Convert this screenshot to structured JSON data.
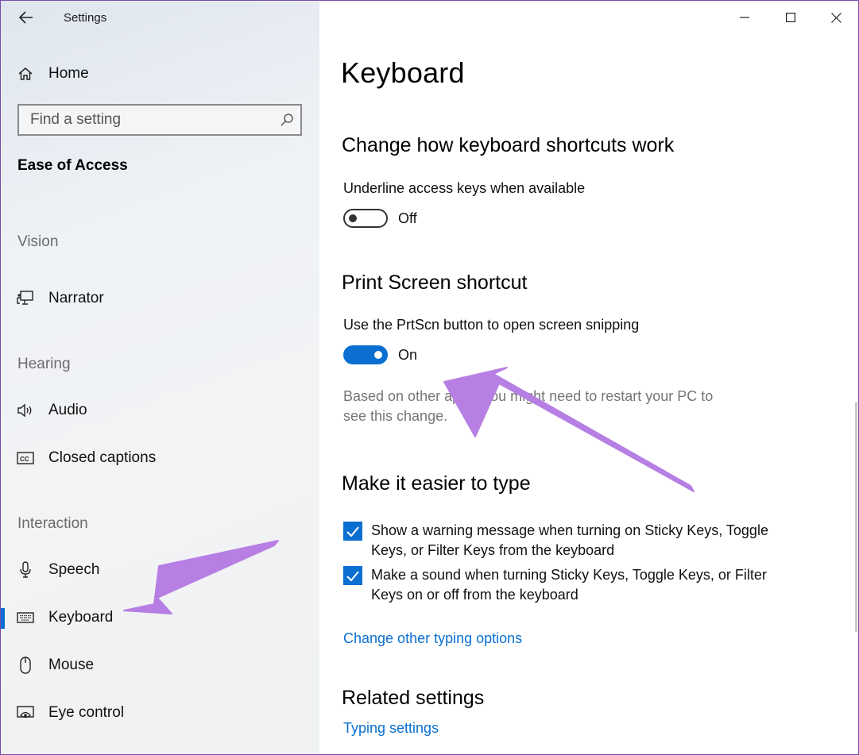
{
  "app": {
    "title": "Settings"
  },
  "sidebar": {
    "home_label": "Home",
    "search": {
      "placeholder": "Find a setting"
    },
    "section_title": "Ease of Access",
    "groups": [
      {
        "label": "Vision",
        "items": [
          {
            "label": "Narrator",
            "icon": "narrator-icon"
          }
        ]
      },
      {
        "label": "Hearing",
        "items": [
          {
            "label": "Audio",
            "icon": "speaker-icon"
          },
          {
            "label": "Closed captions",
            "icon": "closed-captions-icon"
          }
        ]
      },
      {
        "label": "Interaction",
        "items": [
          {
            "label": "Speech",
            "icon": "microphone-icon"
          },
          {
            "label": "Keyboard",
            "icon": "keyboard-icon",
            "selected": true
          },
          {
            "label": "Mouse",
            "icon": "mouse-icon"
          },
          {
            "label": "Eye control",
            "icon": "eye-control-icon"
          }
        ]
      }
    ]
  },
  "main": {
    "title": "Keyboard",
    "sections": {
      "shortcuts": {
        "heading": "Change how keyboard shortcuts work",
        "setting_label": "Underline access keys when available",
        "toggle_state": "Off"
      },
      "print_screen": {
        "heading": "Print Screen shortcut",
        "setting_label": "Use the PrtScn button to open screen snipping",
        "toggle_state": "On",
        "note_line1": "Based on other apps, you might need to restart your PC to",
        "note_line2": "see this change."
      },
      "typing": {
        "heading": "Make it easier to type",
        "checkbox1_line1": "Show a warning message when turning on Sticky Keys, Toggle",
        "checkbox1_line2": "Keys, or Filter Keys from the keyboard",
        "checkbox2_line1": "Make a sound when turning Sticky Keys, Toggle Keys, or Filter",
        "checkbox2_line2": "Keys on or off from the keyboard",
        "link": "Change other typing options"
      },
      "related": {
        "heading": "Related settings",
        "link": "Typing settings"
      }
    }
  },
  "colors": {
    "accent": "#0a6fd1",
    "annotation_arrow": "#b77fe3"
  }
}
